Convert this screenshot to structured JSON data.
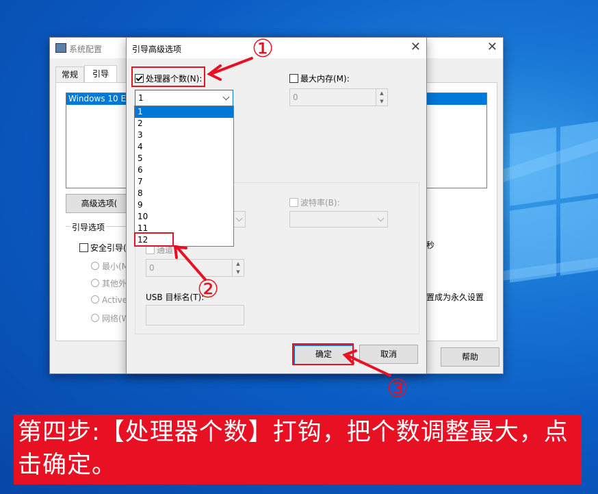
{
  "main_window": {
    "title": "系统配置",
    "tabs": [
      "常规",
      "引导"
    ],
    "boot_list_item": "Windows 10 Er",
    "advanced_button": "高级选项(",
    "boot_options_label": "引导选项",
    "safe_boot_label": "安全引导(",
    "radio_options": [
      "最小(M",
      "其他外",
      "Active",
      "网络(W"
    ],
    "timeout_suffix": "秒",
    "permanent_label": "置成为永久设置",
    "help_button": "帮助"
  },
  "dialog": {
    "title": "引导高级选项",
    "processors_label": "处理器个数(N):",
    "processors_value": "1",
    "processors_options": [
      "1",
      "2",
      "3",
      "4",
      "5",
      "6",
      "7",
      "8",
      "9",
      "10",
      "11",
      "12"
    ],
    "max_memory_label": "最大内存(M):",
    "max_memory_value": "0",
    "baud_rate_label": "波特率(B):",
    "channel_label": "通道",
    "channel_value": "0",
    "usb_target_label": "USB 目标名(T):",
    "ok_button": "确定",
    "cancel_button": "取消"
  },
  "annotations": {
    "step1": "①",
    "step2": "②",
    "step3": "③",
    "red_color": "#e81123"
  },
  "caption": "第四步:【处理器个数】打钩，把个数调整最大，点击确定。"
}
